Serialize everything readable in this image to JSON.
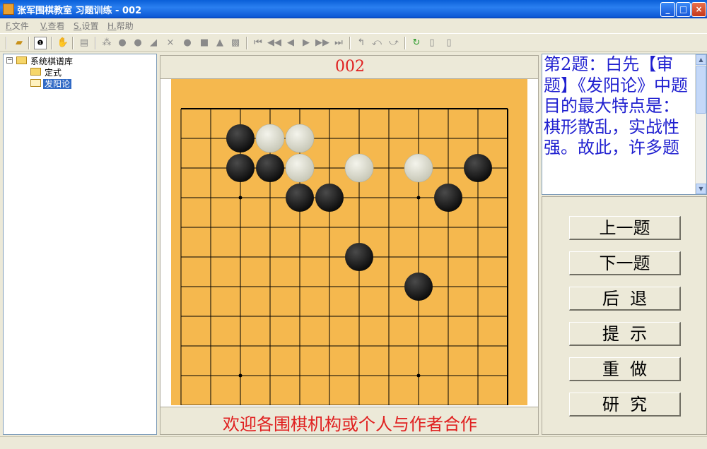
{
  "window": {
    "title": "张军围棋教室 习题训练 - 002",
    "controls": {
      "minimize": "_",
      "maximize": "□",
      "close": "×"
    }
  },
  "menu": [
    {
      "key": "F.",
      "label": "文件"
    },
    {
      "key": "V.",
      "label": "查看"
    },
    {
      "key": "S.",
      "label": "设置"
    },
    {
      "key": "H.",
      "label": "帮助"
    }
  ],
  "toolbar_icons": [
    "open-folder-icon",
    "move-number-icon",
    "hand-icon",
    "book-icon",
    "stones-icon",
    "black-stone-icon",
    "white-stone-icon",
    "triangle-mark-icon",
    "cross-mark-icon",
    "circle-mark-icon",
    "square-mark-icon",
    "up-triangle-icon",
    "fill-square-icon",
    "first-move-icon",
    "fast-back-icon",
    "back-icon",
    "forward-icon",
    "fast-forward-icon",
    "last-move-icon",
    "branch-up-icon",
    "branch-left-icon",
    "branch-right-icon",
    "refresh-icon",
    "new-file-icon",
    "save-file-icon"
  ],
  "tree": {
    "root": "系统棋谱库",
    "expander": "−",
    "children": [
      {
        "label": "定式",
        "selected": false
      },
      {
        "label": "发阳论",
        "selected": true
      }
    ]
  },
  "board": {
    "title": "002",
    "size_lines": 12,
    "board_color": "#f5b84e",
    "black_stones": [
      [
        3,
        1
      ],
      [
        3,
        2
      ],
      [
        4,
        2
      ],
      [
        5,
        3
      ],
      [
        6,
        3
      ],
      [
        10,
        3
      ],
      [
        11,
        2
      ],
      [
        7,
        5
      ],
      [
        9,
        6
      ]
    ],
    "white_stones": [
      [
        4,
        1
      ],
      [
        5,
        1
      ],
      [
        5,
        2
      ],
      [
        7,
        2
      ],
      [
        9,
        2
      ]
    ],
    "star_points": [
      [
        3,
        3
      ],
      [
        9,
        3
      ],
      [
        3,
        9
      ],
      [
        9,
        9
      ]
    ]
  },
  "footer": "欢迎各围棋机构或个人与作者合作",
  "problem": {
    "text": "第2题：白先【审题】《发阳论》中题目的最大特点是：棋形散乱，实战性强。故此，许多题",
    "text_color": "#2020d0"
  },
  "buttons": {
    "prev": "上一题",
    "next": "下一题",
    "undo": "后  退",
    "hint": "提  示",
    "redo": "重  做",
    "study": "研  究"
  }
}
